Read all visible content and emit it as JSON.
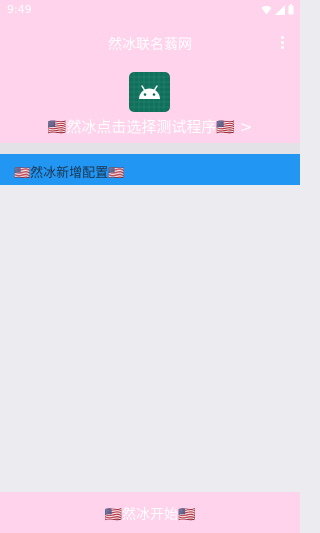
{
  "status_bar": {
    "time": "9:49"
  },
  "app_bar": {
    "title": "然冰联名蓊网"
  },
  "select_program": {
    "label": "🇺🇸然冰点击选择测试程序🇺🇸 >"
  },
  "config_list": {
    "items": [
      {
        "label": "🇺🇸然冰新增配置🇺🇸"
      }
    ]
  },
  "bottom": {
    "start_label": "🇺🇸然冰开始🇺🇸"
  },
  "colors": {
    "header_bg": "#ffd3ec",
    "accent_blue": "#2196f3",
    "app_icon_bg": "#10705c",
    "page_bg": "#ececf0"
  }
}
